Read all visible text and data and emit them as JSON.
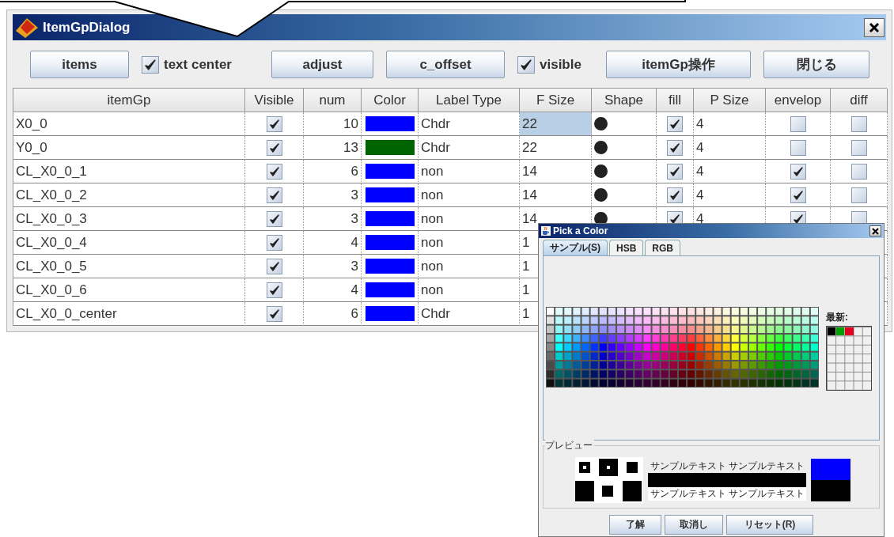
{
  "dialog": {
    "title": "ItemGpDialog",
    "toolbar": [
      {
        "kind": "button",
        "label": "items"
      },
      {
        "kind": "checkbox",
        "label": "text center",
        "checked": true
      },
      {
        "kind": "button",
        "label": "adjust"
      },
      {
        "kind": "button",
        "label": "c_offset"
      },
      {
        "kind": "checkbox",
        "label": "visible",
        "checked": true
      },
      {
        "kind": "button",
        "label": "itemGp操作"
      },
      {
        "kind": "button",
        "label": "閉じる"
      }
    ],
    "table": {
      "columns": [
        "itemGp",
        "Visible",
        "num",
        "Color",
        "Label Type",
        "F Size",
        "Shape",
        "fill",
        "P Size",
        "envelop",
        "diff"
      ],
      "rows": [
        {
          "item_gp": "X0_0",
          "visible": true,
          "num": "10",
          "color": "#0000ff",
          "label_type": "Chdr",
          "f_size": "22",
          "selected": true,
          "fill": true,
          "p_size": "4",
          "envelop": false,
          "diff": false
        },
        {
          "item_gp": "Y0_0",
          "visible": true,
          "num": "13",
          "color": "#006400",
          "label_type": "Chdr",
          "f_size": "22",
          "selected": false,
          "fill": true,
          "p_size": "4",
          "envelop": false,
          "diff": false
        },
        {
          "item_gp": "CL_X0_0_1",
          "visible": true,
          "num": "6",
          "color": "#0000ff",
          "label_type": "non",
          "f_size": "14",
          "selected": false,
          "fill": true,
          "p_size": "4",
          "envelop": true,
          "diff": false
        },
        {
          "item_gp": "CL_X0_0_2",
          "visible": true,
          "num": "3",
          "color": "#0000ff",
          "label_type": "non",
          "f_size": "14",
          "selected": false,
          "fill": true,
          "p_size": "4",
          "envelop": true,
          "diff": false
        },
        {
          "item_gp": "CL_X0_0_3",
          "visible": true,
          "num": "3",
          "color": "#0000ff",
          "label_type": "non",
          "f_size": "14",
          "selected": false,
          "fill": true,
          "p_size": "4",
          "envelop": true,
          "diff": false
        },
        {
          "item_gp": "CL_X0_0_4",
          "visible": true,
          "num": "4",
          "color": "#0000ff",
          "label_type": "non",
          "f_size": "1",
          "selected": false
        },
        {
          "item_gp": "CL_X0_0_5",
          "visible": true,
          "num": "3",
          "color": "#0000ff",
          "label_type": "non",
          "f_size": "1",
          "selected": false
        },
        {
          "item_gp": "CL_X0_0_6",
          "visible": true,
          "num": "4",
          "color": "#0000ff",
          "label_type": "non",
          "f_size": "1",
          "selected": false
        },
        {
          "item_gp": "CL_X0_0_center",
          "visible": true,
          "num": "6",
          "color": "#0000ff",
          "label_type": "Chdr",
          "f_size": "1",
          "selected": false
        }
      ]
    }
  },
  "color_picker": {
    "title": "Pick a Color",
    "tabs": [
      {
        "label": "サンプル(S)",
        "selected": true
      },
      {
        "label": "HSB",
        "selected": false
      },
      {
        "label": "RGB",
        "selected": false
      }
    ],
    "recent_label": "最新:",
    "recent": [
      {
        "color": "#000000"
      },
      {
        "color": "#00a000"
      },
      {
        "color": "#e00020"
      }
    ],
    "preview": {
      "title": "プレビュー",
      "sample_texts": [
        "サンプルテキスト サンプルテキスト",
        "サンプルテキスト サンプルテキスト"
      ],
      "color": "#0000ff"
    },
    "buttons": [
      "了解",
      "取消し",
      "リセット(R)"
    ]
  }
}
